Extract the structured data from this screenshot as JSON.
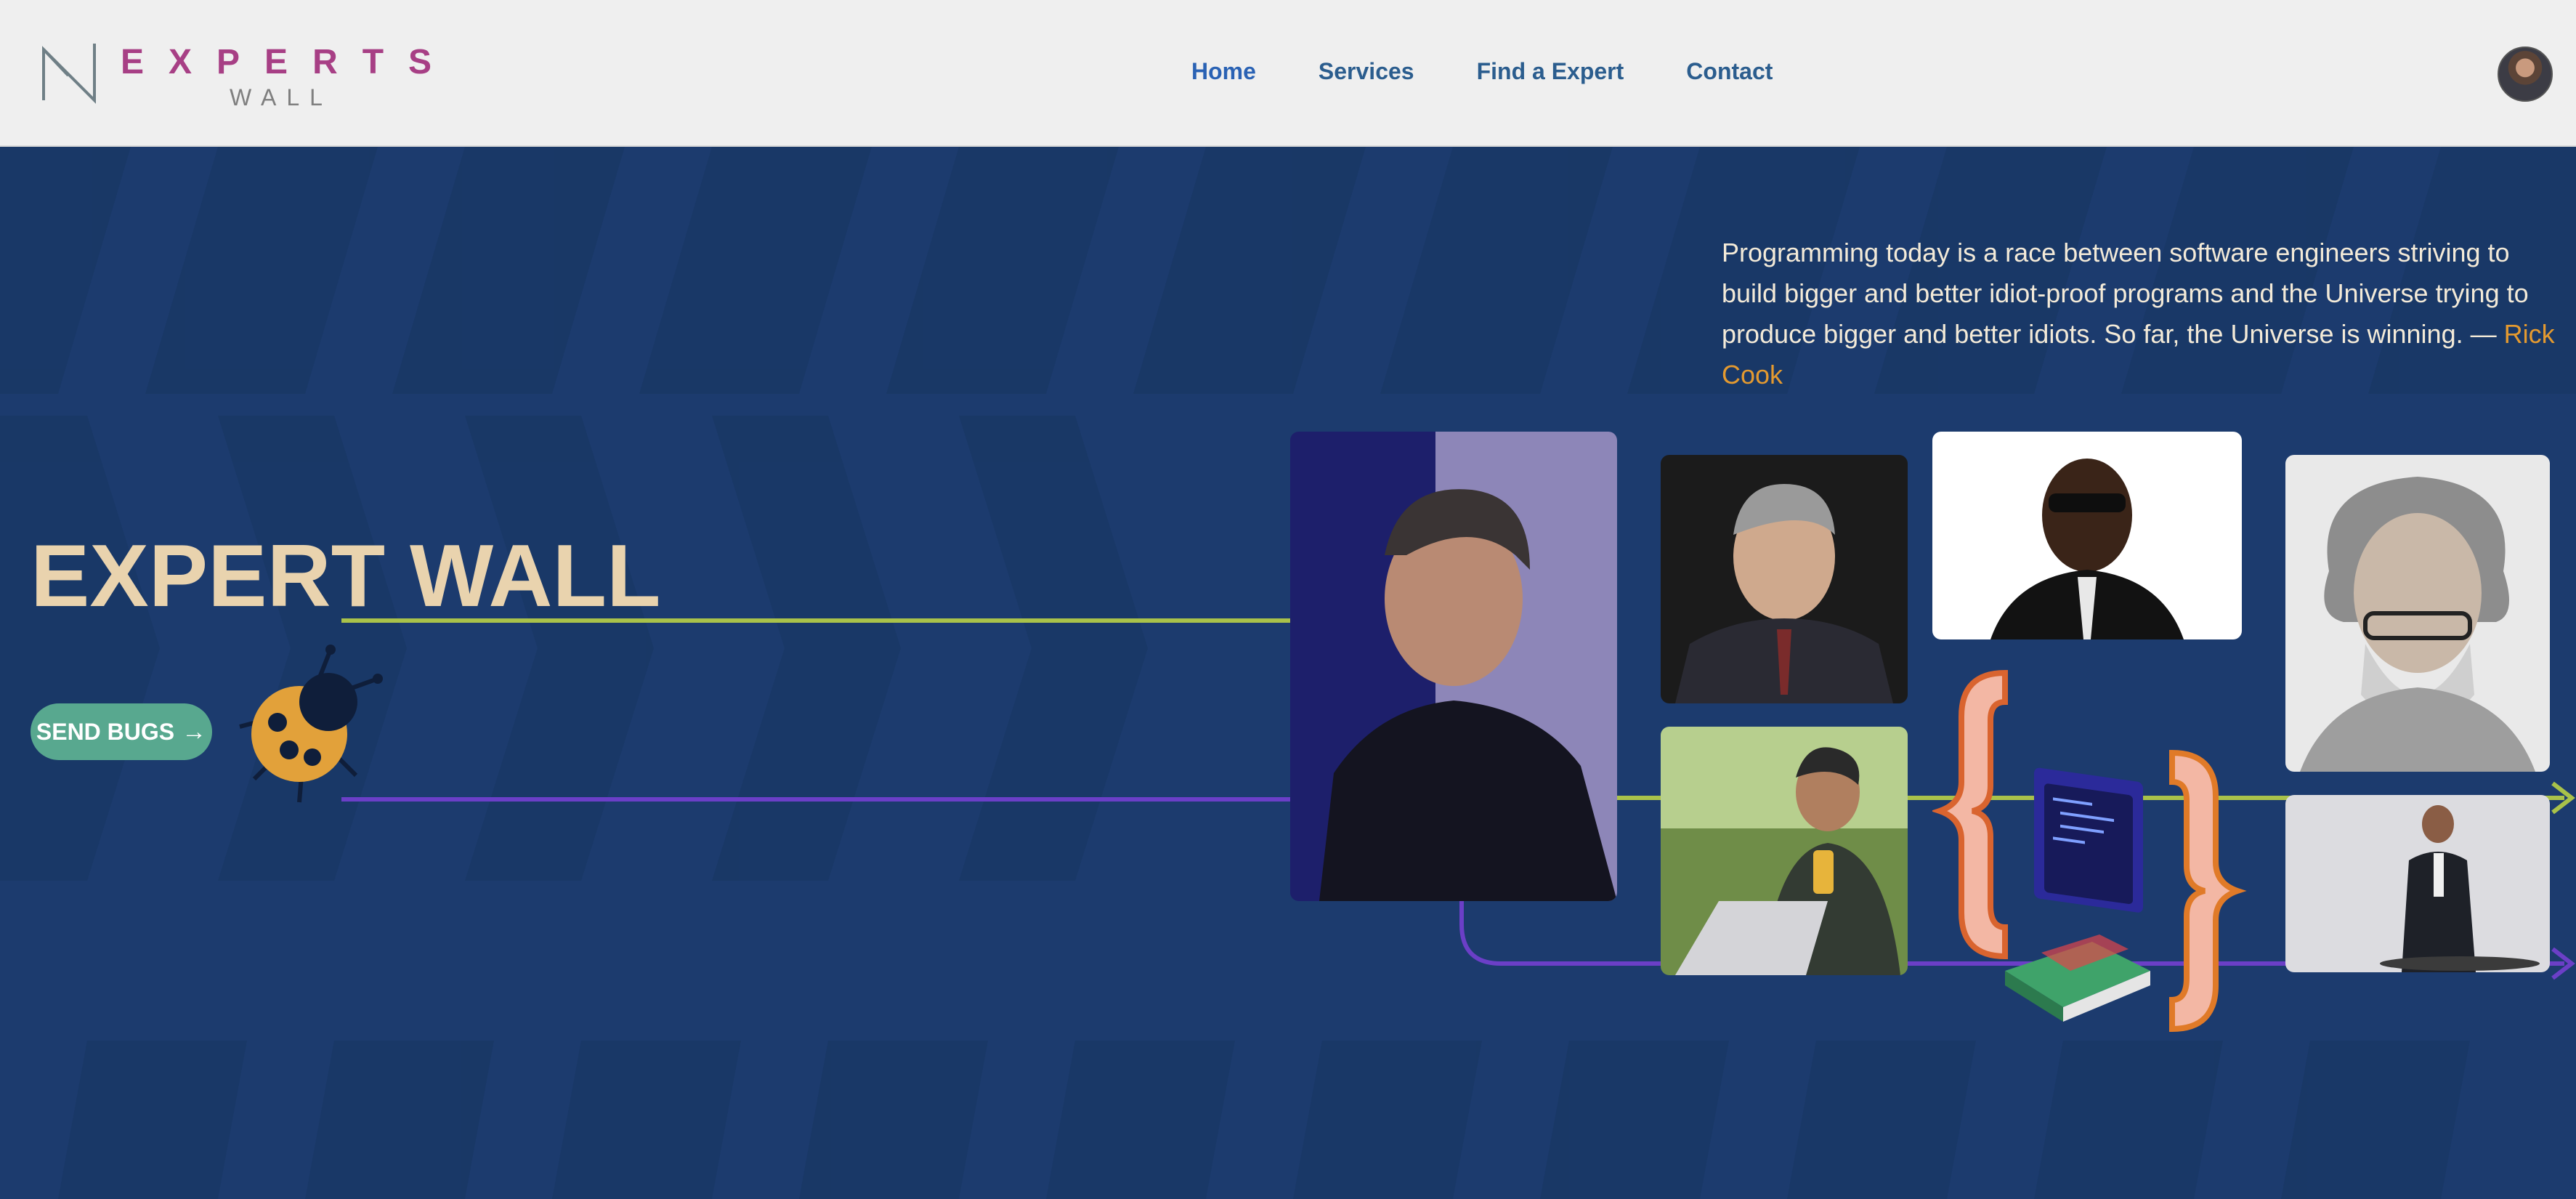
{
  "brand": {
    "name": "EXPERTS",
    "sub": "WALL"
  },
  "nav": {
    "items": [
      {
        "label": "Home"
      },
      {
        "label": "Services"
      },
      {
        "label": "Find a Expert"
      },
      {
        "label": "Contact"
      }
    ]
  },
  "hero": {
    "title": "EXPERT WALL",
    "button_label": "SEND BUGS",
    "button_icon": "arrow-right-icon",
    "quote_text": "Programming today is a race between software engineers striving to build bigger and better idiot-proof programs and the Universe trying to produce bigger and better idiots. So far, the Universe is winning. —",
    "quote_author": "Rick Cook"
  },
  "colors": {
    "header_bg": "#efefef",
    "hero_bg": "#1c3b6e",
    "brand": "#a73f85",
    "nav_text": "#2b5d8e",
    "title": "#e9d3ae",
    "button": "#58a88f",
    "quote_author": "#e49a30",
    "line_green": "#a9c24a",
    "line_purple": "#6b3fc7"
  }
}
